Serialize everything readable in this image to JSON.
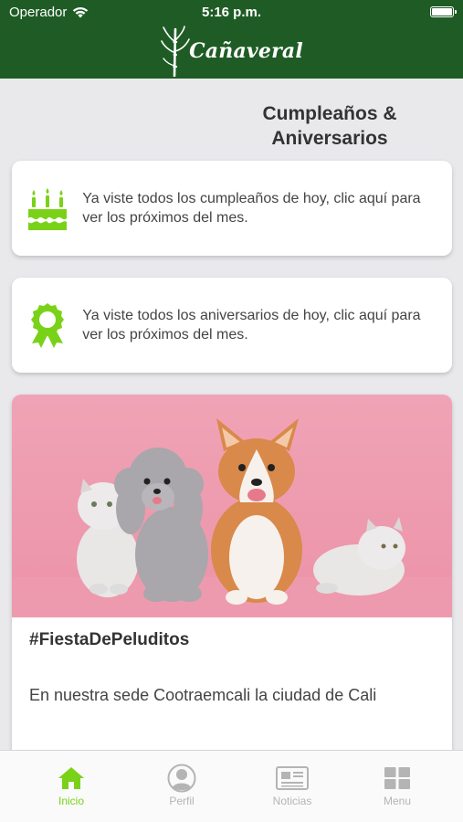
{
  "status_bar": {
    "carrier": "Operador",
    "time": "5:16 p.m.",
    "icons": [
      "wifi-icon",
      "battery-icon"
    ]
  },
  "header": {
    "logo_text": "Cañaveral",
    "logo_icon": "sugarcane-icon"
  },
  "section_title": "Cumpleaños & Aniversarios",
  "cards": {
    "birthdays": {
      "icon": "birthday-cake-icon",
      "text": "Ya viste todos los cumpleaños de hoy, clic aquí para ver los próximos del mes."
    },
    "anniversaries": {
      "icon": "award-ribbon-icon",
      "text": "Ya viste todos los aniversarios de hoy, clic aquí para ver los próximos del mes."
    }
  },
  "post": {
    "image": "pets-photo",
    "title": "#FiestaDePeluditos",
    "body": "En nuestra sede Cootraemcali la ciudad de Cali"
  },
  "tab_bar": {
    "tabs": [
      {
        "label": "Inicio",
        "icon": "home-icon",
        "active": true
      },
      {
        "label": "Perfil",
        "icon": "user-icon",
        "active": false
      },
      {
        "label": "Noticias",
        "icon": "newspaper-icon",
        "active": false
      },
      {
        "label": "Menu",
        "icon": "grid-icon",
        "active": false
      }
    ]
  },
  "colors": {
    "header": "#1f5c25",
    "accent": "#7ad218",
    "inactive": "#b4b4b4",
    "background": "#e9e9ec",
    "photo_background": "#ef9db1"
  }
}
